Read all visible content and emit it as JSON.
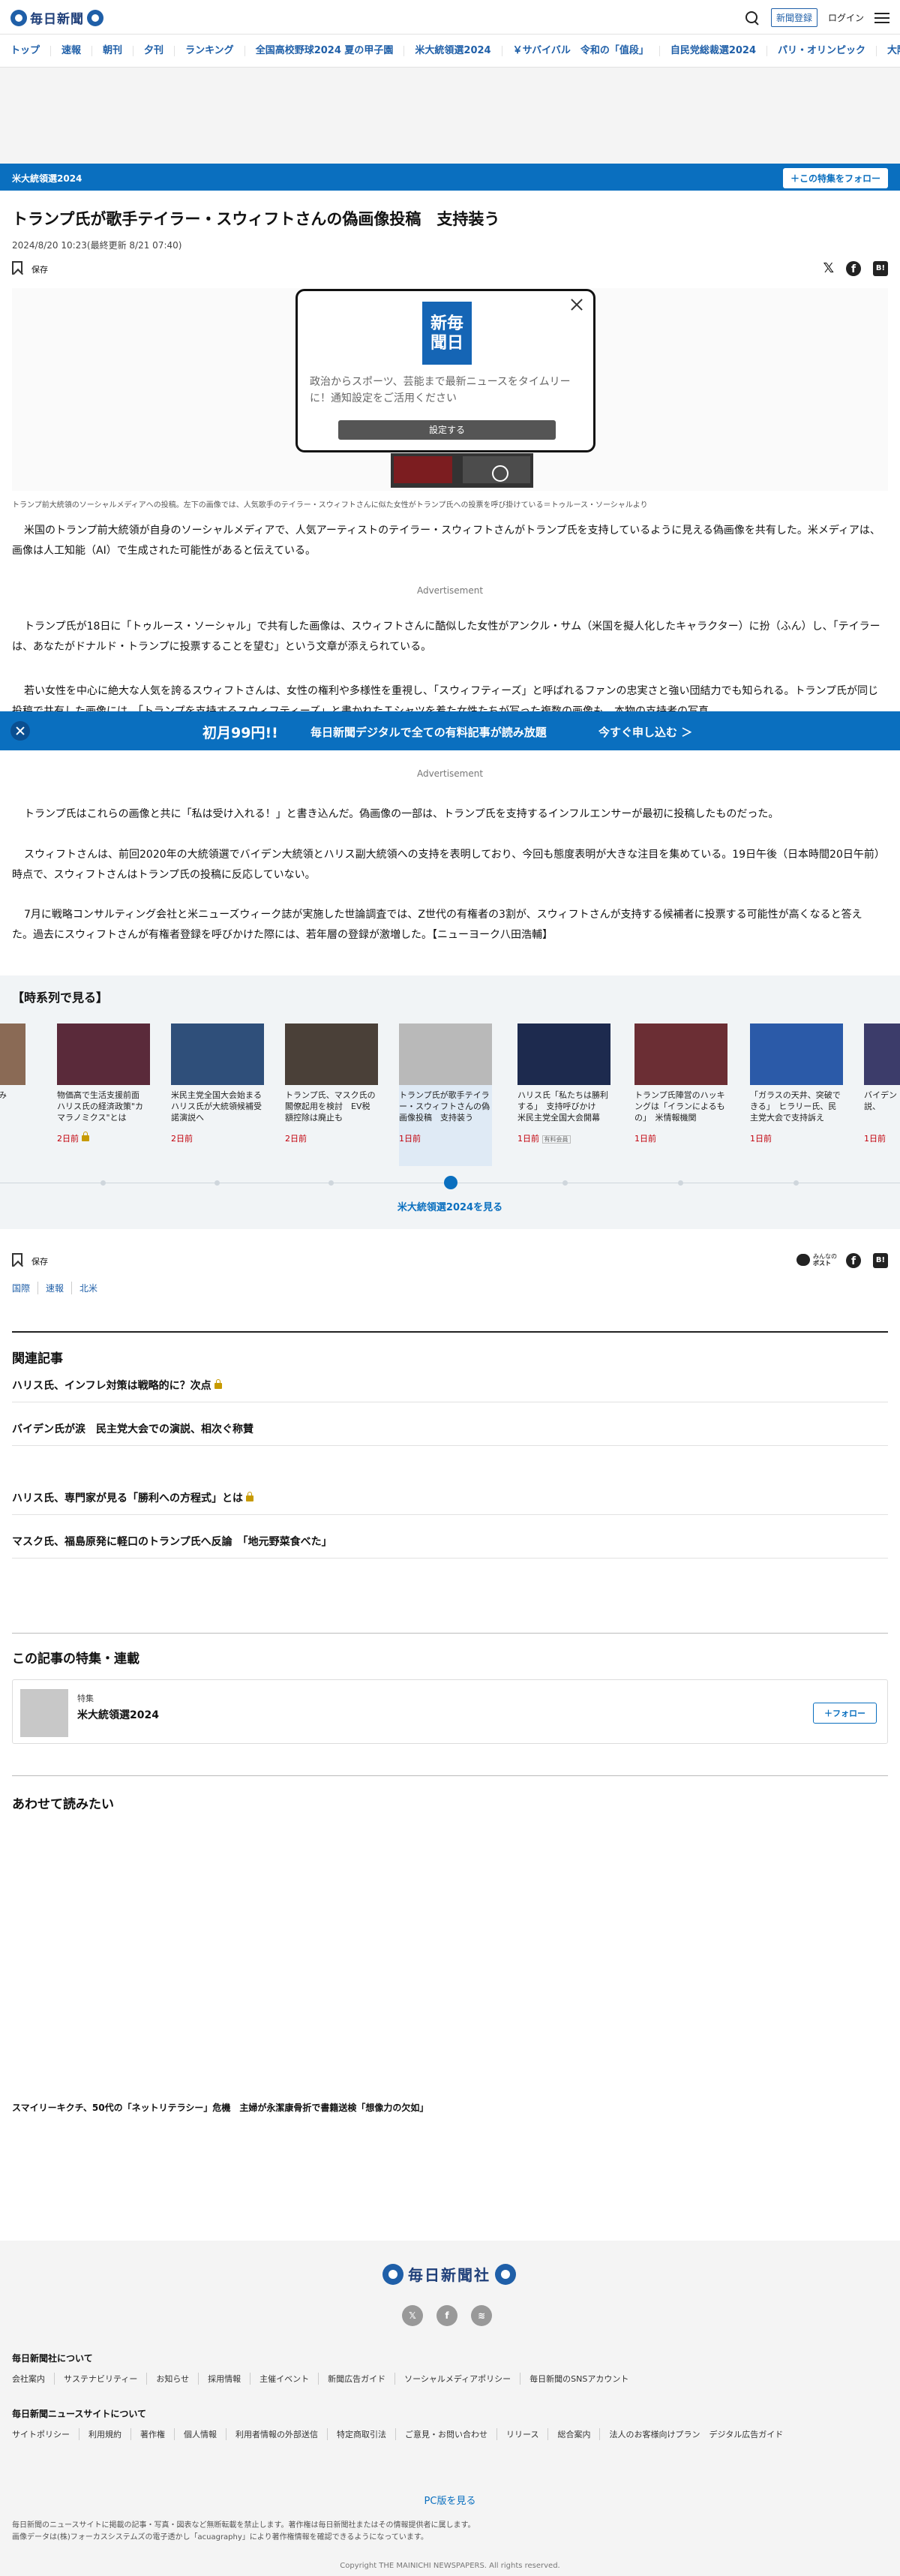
{
  "header": {
    "logo_text": "毎日新聞",
    "register": "新聞登録",
    "login": "ログイン"
  },
  "nav": [
    "トップ",
    "速報",
    "朝刊",
    "夕刊",
    "ランキング",
    "全国高校野球2024 夏の甲子園",
    "米大統領選2024",
    "￥サバイバル　令和の「值段」",
    "自民党総裁選2024",
    "パリ・オリンピック",
    "大阪・関"
  ],
  "topic": {
    "label": "米大統領選2024",
    "follow": "＋この特集をフォロー"
  },
  "article": {
    "title": "トランプ氏が歌手テイラー・スウィフトさんの偽画像投稿　支持装う",
    "date": "2024/8/20 10:23(最終更新 8/21 07:40)",
    "save": "保存",
    "caption": "トランプ前大統領のソーシャルメディアへの投稿。左下の画像では、人気歌手のテイラー・スウィフトさんに似た女性がトランプ氏への投票を呼び掛けている＝トゥルース・ソーシャルより",
    "p1": "米国のトランプ前大統領が自身のソーシャルメディアで、人気アーティストのテイラー・スウィフトさんがトランプ氏を支持しているように見える偽画像を共有した。米メディアは、画像は人工知能（AI）で生成された可能性があると伝えている。",
    "p2": "トランプ氏が18日に「トゥルース・ソーシャル」で共有した画像は、スウィフトさんに酷似した女性がアンクル・サム（米国を擬人化したキャラクター）に扮（ふん）し、「テイラーは、あなたがドナルド・トランプに投票することを望む」という文章が添えられている。",
    "p3": "若い女性を中心に絶大な人気を誇るスウィフトさんは、女性の権利や多様性を重視し、「スウィフティーズ」と呼ばれるファンの忠実さと強い団結力でも知られる。トランプ氏が同じ投稿で共有した画像には、「トランプを支持するスウィフティーズ」と書かれたＴシャツを着た女性たちが写った複数の画像も。本物の支持者の写真",
    "p4": "トランプ氏はこれらの画像と共に「私は受け入れる！」と書き込んだ。偽画像の一部は、トランプ氏を支持するインフルエンサーが最初に投稿したものだった。",
    "p5": "スウィフトさんは、前回2020年の大統領選でバイデン大統領とハリス副大統領への支持を表明しており、今回も態度表明が大きな注目を集めている。19日午後（日本時間20日午前）時点で、スウィフトさんはトランプ氏の投稿に反応していない。",
    "p6": "7月に戦略コンサルティング会社と米ニューズウィーク誌が実施した世論調査では、Z世代の有権者の3割が、スウィフトさんが支持する候補者に投票する可能性が高くなると答えた。過去にスウィフトさんが有権者登録を呼びかけた際には、若年層の登録が激増した。【ニューヨーク八田浩輔】",
    "advertisement": "Advertisement"
  },
  "popup": {
    "logo": "新毎\n聞日",
    "message": "政治からスポーツ、芸能まで最新ニュースをタイムリーに！通知設定をご活用ください",
    "button": "設定する"
  },
  "promo": {
    "price": "初月99円!!",
    "text": "毎日新聞デジタルで全ての有料記事が読み放題",
    "cta": "今すぐ申し込む ＞"
  },
  "series": {
    "heading": "【時系列で見る】",
    "more": "米大統領選2024を見る",
    "cards": [
      {
        "title": "開幕へ　打　に弾み",
        "ago": ""
      },
      {
        "title": "物価高で生活支援前面　ハリス氏の経済政策\"カマラノミクス\"とは",
        "ago": "2日前",
        "lock": true
      },
      {
        "title": "米民主党全国大会始まる　ハリス氏が大統領候補受諾演説へ",
        "ago": "2日前"
      },
      {
        "title": "トランプ氏、マスク氏の閣僚起用を検討　EV税額控除は廃止も",
        "ago": "2日前"
      },
      {
        "title": "トランプ氏が歌手テイラー・スウィフトさんの偽画像投稿　支持装う",
        "ago": "1日前"
      },
      {
        "title": "ハリス氏「私たちは勝利する」　支持呼びかけ　米民主党全国大会開幕",
        "ago": "1日前",
        "badge": "有料会員"
      },
      {
        "title": "トランプ氏陣営のハッキングは「イランによるもの」　米情報機関",
        "ago": "1日前"
      },
      {
        "title": "「ガラスの天井、突破できる」　ヒラリー氏、民主党大会で支持訴え",
        "ago": "1日前"
      },
      {
        "title": "バイデン　し　涙　の演説、",
        "ago": "1日前"
      }
    ]
  },
  "tags": [
    "国際",
    "速報",
    "北米"
  ],
  "post": {
    "line1": "みんなの",
    "line2": "ポスト"
  },
  "related": {
    "heading": "関連記事",
    "items": [
      {
        "title": "ハリス氏、インフレ対策は戦略的に？次点",
        "lock": true
      },
      {
        "title": "バイデン氏が涙　民主党大会での演説、相次ぐ称賛",
        "lock": false
      },
      {
        "title": "ハリス氏、専門家が見る「勝利への方程式」とは",
        "lock": true
      },
      {
        "title": "マスク氏、福島原発に軽口のトランプ氏へ反論　「地元野菜食べた」",
        "lock": false
      }
    ]
  },
  "feature": {
    "heading": "この記事の特集・連載",
    "kind": "特集",
    "name": "米大統領選2024",
    "follow": "＋フォロー"
  },
  "also": {
    "heading": "あわせて読みたい",
    "item": "スマイリーキクチ、50代の「ネットリテラシー」危機　主婦が永潔康骨折で書籍送検「想像力の欠如」"
  },
  "footer": {
    "logo_text": "毎日新聞社",
    "about_heading": "毎日新聞社について",
    "about_links": [
      "会社案内",
      "サステナビリティー",
      "お知らせ",
      "採用情報",
      "主催イベント",
      "新聞広告ガイド",
      "ソーシャルメディアポリシー",
      "毎日新聞のSNSアカウント"
    ],
    "site_heading": "毎日新聞ニュースサイトについて",
    "site_links": [
      "サイトポリシー",
      "利用規約",
      "著作権",
      "個人情報",
      "利用者情報の外部送信",
      "特定商取引法",
      "ご意見・お問い合わせ",
      "リリース",
      "総合案内",
      "法人のお客様向けプラン",
      "デジタル広告ガイド"
    ],
    "pc": "PC版を見る",
    "note1": "毎日新聞のニュースサイトに掲載の記事・写真・図表など無断転載を禁止します。著作権は毎日新聞社またはその情報提供者に属します。",
    "note2": "画像データは(株)フォーカスシステムズの電子透かし「acuagraphy」により著作権情報を確認できるようになっています。",
    "copyright": "Copyright THE MAINICHI NEWSPAPERS. All rights reserved."
  }
}
